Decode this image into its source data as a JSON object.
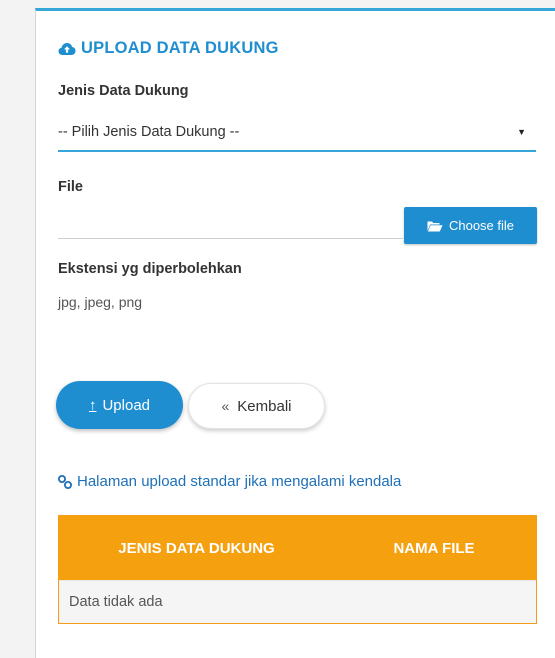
{
  "title": "UPLOAD DATA DUKUNG",
  "form": {
    "jenis_label": "Jenis Data Dukung",
    "jenis_selected": "-- Pilih Jenis Data Dukung --",
    "file_label": "File",
    "choose_file": "Choose file",
    "ext_label": "Ekstensi yg diperbolehkan",
    "ext_values": "jpg, jpeg, png"
  },
  "buttons": {
    "upload": "Upload",
    "back": "Kembali"
  },
  "link_text": "Halaman upload standar jika mengalami kendala",
  "table": {
    "columns": [
      "JENIS DATA DUKUNG",
      "NAMA FILE"
    ],
    "empty": "Data tidak ada"
  },
  "colors": {
    "primary": "#1f8ed0",
    "table_header": "#f5a00f",
    "card_accent": "#35a6d7"
  },
  "icons": {
    "title": "cloud-upload-icon",
    "choose_file": "folder-open-icon",
    "upload": "upload-arrow-icon",
    "back": "double-chevron-left-icon",
    "link": "link-icon"
  }
}
